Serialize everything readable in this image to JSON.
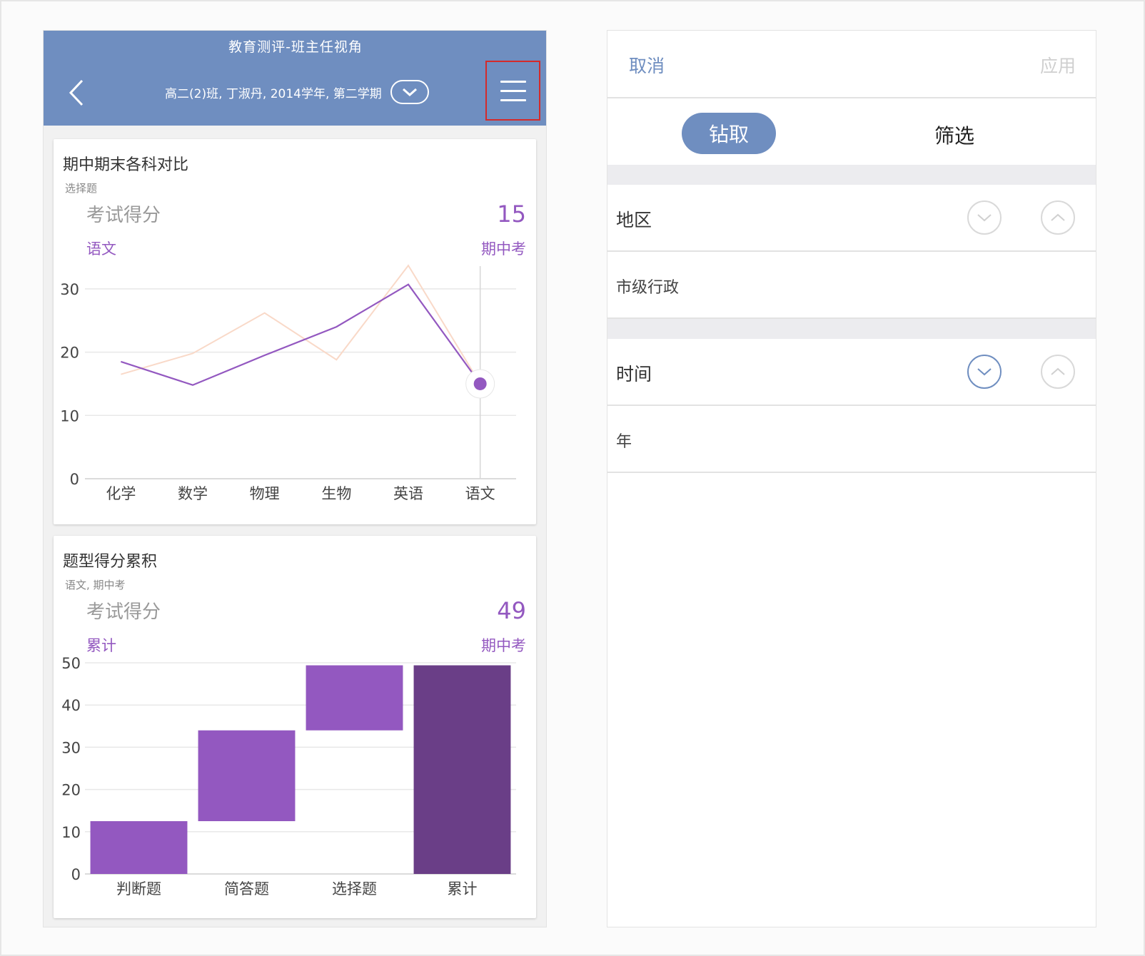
{
  "header": {
    "title": "教育测评-班主任视角",
    "context": "高二(2)班, 丁淑丹, 2014学年, 第二学期",
    "back_icon": "chevron-left-icon",
    "dropdown_icon": "chevron-down-icon",
    "menu_icon": "hamburger-menu-icon"
  },
  "card1": {
    "title": "期中期末各科对比",
    "subtitle": "选择题",
    "metric_label": "考试得分",
    "metric_value": "15",
    "series_label": "语文",
    "period_label": "期中考"
  },
  "card2": {
    "title": "题型得分累积",
    "subtitle": "语文, 期中考",
    "metric_label": "考试得分",
    "metric_value": "49",
    "series_label": "累计",
    "period_label": "期中考"
  },
  "chart_data": [
    {
      "type": "line",
      "categories": [
        "化学",
        "数学",
        "物理",
        "生物",
        "英语",
        "语文"
      ],
      "series": [
        {
          "values": [
            18.5,
            14.8,
            19.5,
            24,
            30.7,
            15
          ],
          "color": "#9358c0"
        },
        {
          "values": [
            16.5,
            19.8,
            26.2,
            18.8,
            33.7,
            15
          ],
          "color": "#f9d9c8"
        }
      ],
      "ylim": [
        0,
        30
      ],
      "yticks": [
        0,
        10,
        20,
        30
      ],
      "highlight": {
        "category": "语文",
        "value": 15
      },
      "grid": true
    },
    {
      "type": "bar",
      "subtype": "waterfall",
      "categories": [
        "判断题",
        "简答题",
        "选择题",
        "累计"
      ],
      "ranges": [
        [
          0,
          12.5
        ],
        [
          12.5,
          34
        ],
        [
          34,
          49.4
        ],
        [
          0,
          49.4
        ]
      ],
      "colors": [
        "#9358c0",
        "#9358c0",
        "#9358c0",
        "#6a3e87"
      ],
      "ylim": [
        0,
        50
      ],
      "yticks": [
        0,
        10,
        20,
        30,
        40,
        50
      ],
      "grid": true
    }
  ],
  "panel": {
    "cancel": "取消",
    "apply": "应用",
    "tab_drill": "钻取",
    "tab_filter": "筛选",
    "section1_label": "地区",
    "section1_value": "市级行政",
    "section2_label": "时间",
    "section2_value": "年",
    "down_icon": "chevron-down-icon",
    "up_icon": "chevron-up-icon"
  }
}
